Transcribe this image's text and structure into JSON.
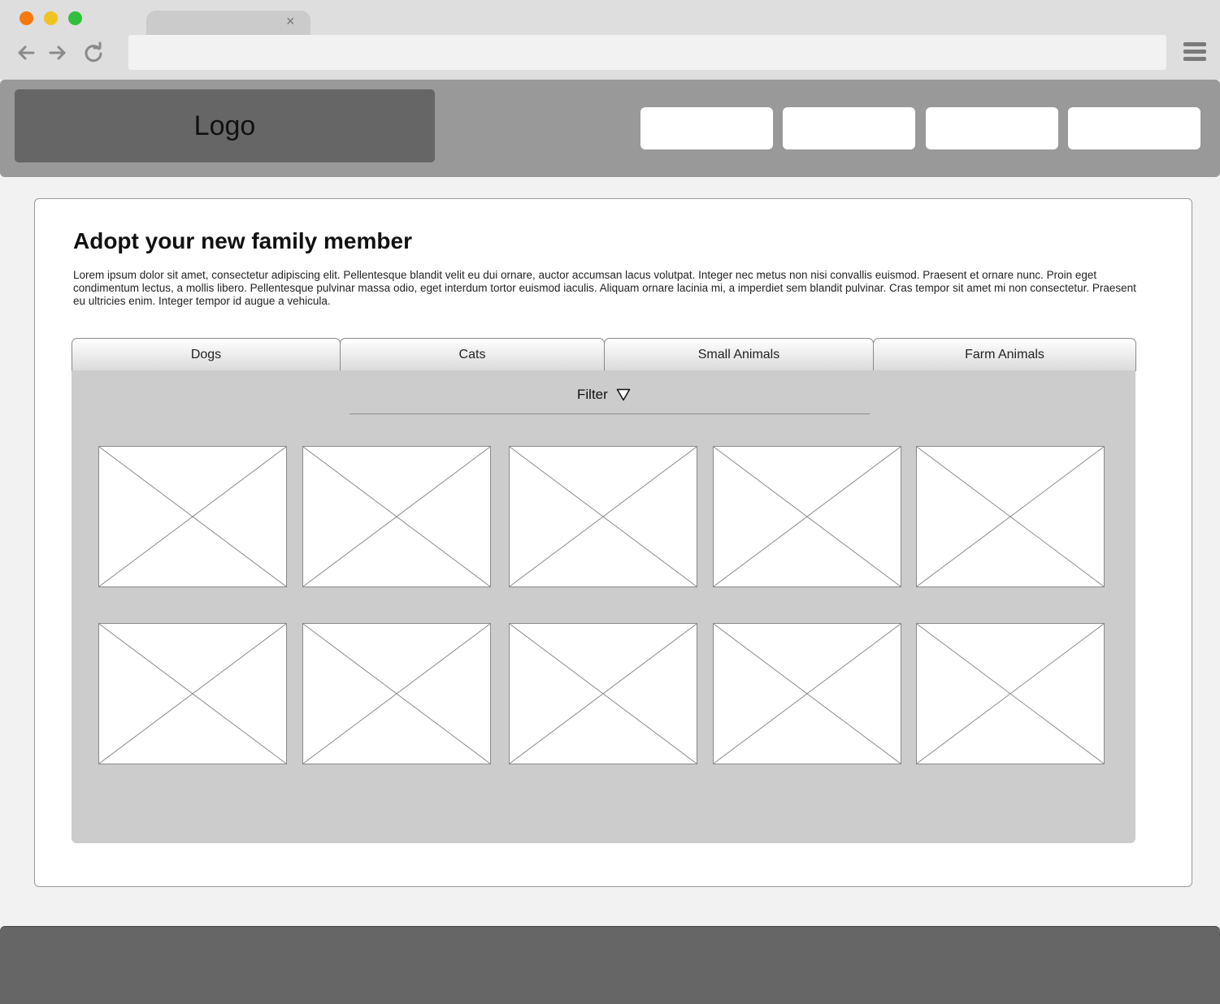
{
  "browser": {
    "tab_close": "×",
    "address_value": ""
  },
  "header": {
    "logo": "Logo",
    "nav_buttons": [
      "",
      "",
      "",
      ""
    ]
  },
  "main": {
    "title": "Adopt your new family member",
    "description": "Lorem ipsum dolor sit amet, consectetur adipiscing elit. Pellentesque blandit velit eu dui ornare, auctor accumsan lacus volutpat. Integer nec metus non nisi convallis euismod. Praesent et ornare nunc. Proin eget condimentum lectus, a mollis libero. Pellentesque pulvinar massa odio, eget interdum tortor euismod iaculis. Aliquam ornare lacinia mi, a imperdiet sem blandit pulvinar. Cras tempor sit amet mi non consectetur. Praesent eu ultricies enim. Integer tempor id augue a vehicula.",
    "tabs": [
      {
        "label": "Dogs"
      },
      {
        "label": "Cats"
      },
      {
        "label": "Small Animals"
      },
      {
        "label": "Farm Animals"
      }
    ],
    "filter": {
      "label": "Filter"
    },
    "image_placeholder_count": 10
  },
  "colors": {
    "chrome": "#dedede",
    "header": "#999999",
    "logo_bg": "#666666",
    "panel": "#cccccc",
    "footer": "#666666",
    "traffic_red": "#f7780e",
    "traffic_yellow": "#f0c320",
    "traffic_green": "#2fc13c"
  }
}
